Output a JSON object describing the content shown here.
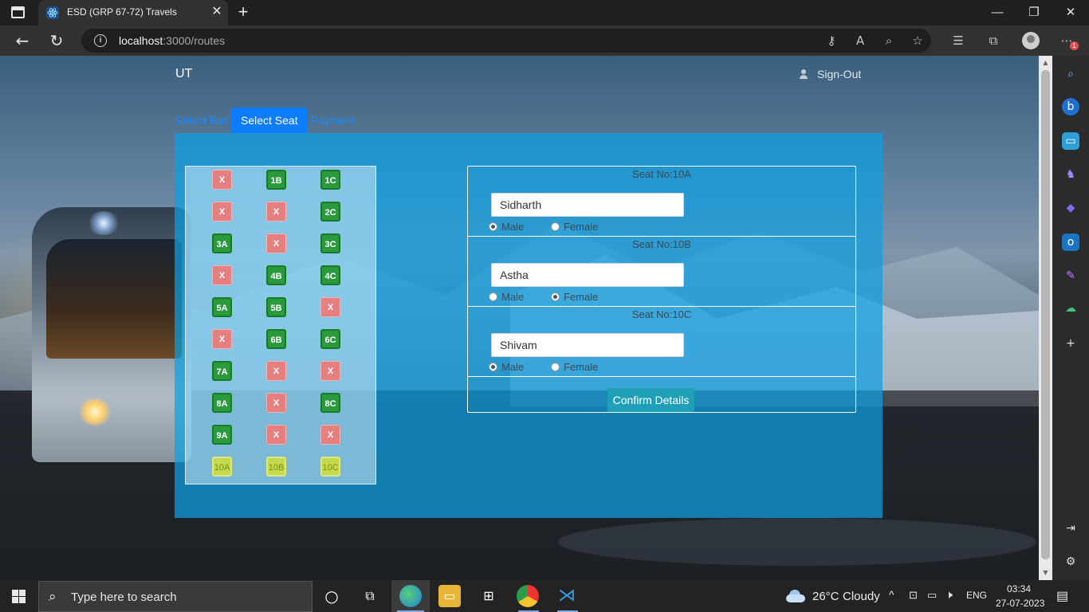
{
  "browser": {
    "tab_title": "ESD (GRP 67-72) Travels",
    "tab_close": "✕",
    "new_tab": "+",
    "minimize": "—",
    "maximize": "❐",
    "close": "✕",
    "url_host": "localhost",
    "url_path": ":3000/routes",
    "toolbar_icons": [
      "key-icon",
      "read-aloud-icon",
      "zoom-icon",
      "favorite-add-icon",
      "favorites-icon",
      "collections-icon",
      "profile-icon",
      "menu-icon"
    ],
    "notification_count": "1"
  },
  "site": {
    "brand": "UT",
    "signout": "Sign-Out",
    "steps": [
      {
        "label": "Select Bus",
        "active": false
      },
      {
        "label": "Select Seat",
        "active": true
      },
      {
        "label": "Payment",
        "active": false
      }
    ]
  },
  "seats": [
    {
      "label": "X",
      "status": "booked"
    },
    {
      "label": "1B",
      "status": "available"
    },
    {
      "label": "1C",
      "status": "available"
    },
    {
      "label": "X",
      "status": "booked"
    },
    {
      "label": "X",
      "status": "booked"
    },
    {
      "label": "2C",
      "status": "available"
    },
    {
      "label": "3A",
      "status": "available"
    },
    {
      "label": "X",
      "status": "booked"
    },
    {
      "label": "3C",
      "status": "available"
    },
    {
      "label": "X",
      "status": "booked"
    },
    {
      "label": "4B",
      "status": "available"
    },
    {
      "label": "4C",
      "status": "available"
    },
    {
      "label": "5A",
      "status": "available"
    },
    {
      "label": "5B",
      "status": "available"
    },
    {
      "label": "X",
      "status": "booked"
    },
    {
      "label": "X",
      "status": "booked"
    },
    {
      "label": "6B",
      "status": "available"
    },
    {
      "label": "6C",
      "status": "available"
    },
    {
      "label": "7A",
      "status": "available"
    },
    {
      "label": "X",
      "status": "booked"
    },
    {
      "label": "X",
      "status": "booked"
    },
    {
      "label": "8A",
      "status": "available"
    },
    {
      "label": "X",
      "status": "booked"
    },
    {
      "label": "8C",
      "status": "available"
    },
    {
      "label": "9A",
      "status": "available"
    },
    {
      "label": "X",
      "status": "booked"
    },
    {
      "label": "X",
      "status": "booked"
    },
    {
      "label": "10A",
      "status": "selected"
    },
    {
      "label": "10B",
      "status": "selected"
    },
    {
      "label": "10C",
      "status": "selected"
    }
  ],
  "passengers": [
    {
      "seat_label": "Seat No:10A",
      "name": "Sidharth",
      "male": "Male",
      "female": "Female",
      "gender": "male"
    },
    {
      "seat_label": "Seat No:10B",
      "name": "Astha",
      "male": "Male",
      "female": "Female",
      "gender": "female"
    },
    {
      "seat_label": "Seat No:10C",
      "name": "Shivam",
      "male": "Male",
      "female": "Female",
      "gender": "male"
    }
  ],
  "confirm_label": "Confirm Details",
  "taskbar": {
    "search_placeholder": "Type here to search",
    "weather_temp": "26°C",
    "weather_text": "Cloudy",
    "language": "ENG",
    "time": "03:34",
    "date": "27-07-2023"
  },
  "colors": {
    "panel": "#0ea0e2",
    "booked": "#e57f80",
    "available": "#2b9a3e",
    "selected": "#c4d94c",
    "active_step": "#0d7cff",
    "confirm": "#1fa0b8"
  }
}
